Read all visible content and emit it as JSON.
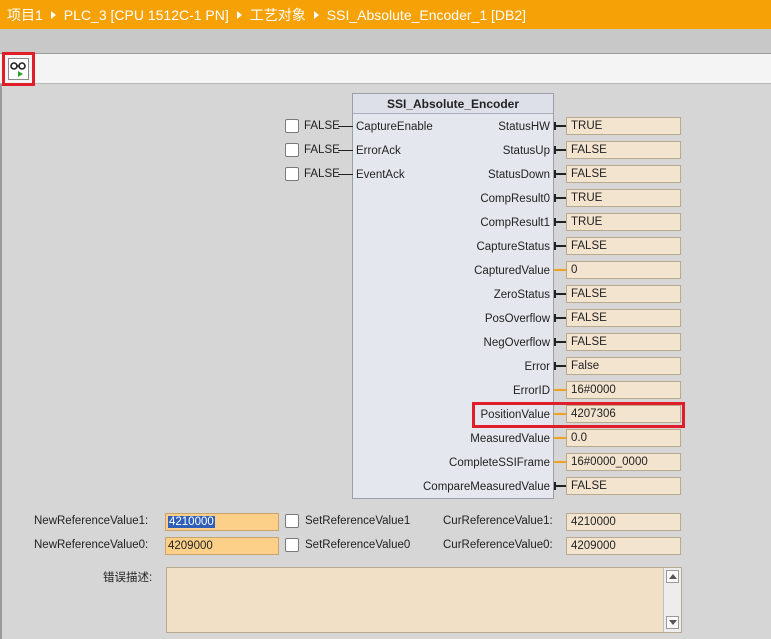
{
  "breadcrumb": [
    "项目1",
    "PLC_3 [CPU 1512C-1 PN]",
    "工艺对象",
    "SSI_Absolute_Encoder_1 [DB2]"
  ],
  "toolbar": {
    "monitor_icon": "glasses-monitor-icon"
  },
  "block": {
    "title": "SSI_Absolute_Encoder",
    "inputs": [
      {
        "name": "CaptureEnable",
        "value": "FALSE"
      },
      {
        "name": "ErrorAck",
        "value": "FALSE"
      },
      {
        "name": "EventAck",
        "value": "FALSE"
      }
    ],
    "outputs": [
      {
        "name": "StatusHW",
        "value": "TRUE",
        "type": "bool"
      },
      {
        "name": "StatusUp",
        "value": "FALSE",
        "type": "bool"
      },
      {
        "name": "StatusDown",
        "value": "FALSE",
        "type": "bool"
      },
      {
        "name": "CompResult0",
        "value": "TRUE",
        "type": "bool"
      },
      {
        "name": "CompResult1",
        "value": "TRUE",
        "type": "bool"
      },
      {
        "name": "CaptureStatus",
        "value": "FALSE",
        "type": "bool"
      },
      {
        "name": "CapturedValue",
        "value": "0",
        "type": "num"
      },
      {
        "name": "ZeroStatus",
        "value": "FALSE",
        "type": "bool"
      },
      {
        "name": "PosOverflow",
        "value": "FALSE",
        "type": "bool"
      },
      {
        "name": "NegOverflow",
        "value": "FALSE",
        "type": "bool"
      },
      {
        "name": "Error",
        "value": "False",
        "type": "bool"
      },
      {
        "name": "ErrorID",
        "value": "16#0000",
        "type": "num"
      },
      {
        "name": "PositionValue",
        "value": "4207306",
        "type": "num"
      },
      {
        "name": "MeasuredValue",
        "value": "0.0",
        "type": "num"
      },
      {
        "name": "CompleteSSIFrame",
        "value": "16#0000_0000",
        "type": "num"
      },
      {
        "name": "CompareMeasuredValue",
        "value": "FALSE",
        "type": "bool"
      }
    ]
  },
  "reference": {
    "new1_label": "NewReferenceValue1:",
    "new1_value": "4210000",
    "new0_label": "NewReferenceValue0:",
    "new0_value": "4209000",
    "set1_label": "SetReferenceValue1",
    "set0_label": "SetReferenceValue0",
    "cur1_label": "CurReferenceValue1:",
    "cur1_value": "4210000",
    "cur0_label": "CurReferenceValue0:",
    "cur0_value": "4209000"
  },
  "error_desc": {
    "label": "错误描述:",
    "value": ""
  },
  "colors": {
    "title_bar": "#f6a105",
    "highlight": "#e01e2a",
    "input_field": "#fcd089",
    "output_field": "#f3e4cf"
  }
}
